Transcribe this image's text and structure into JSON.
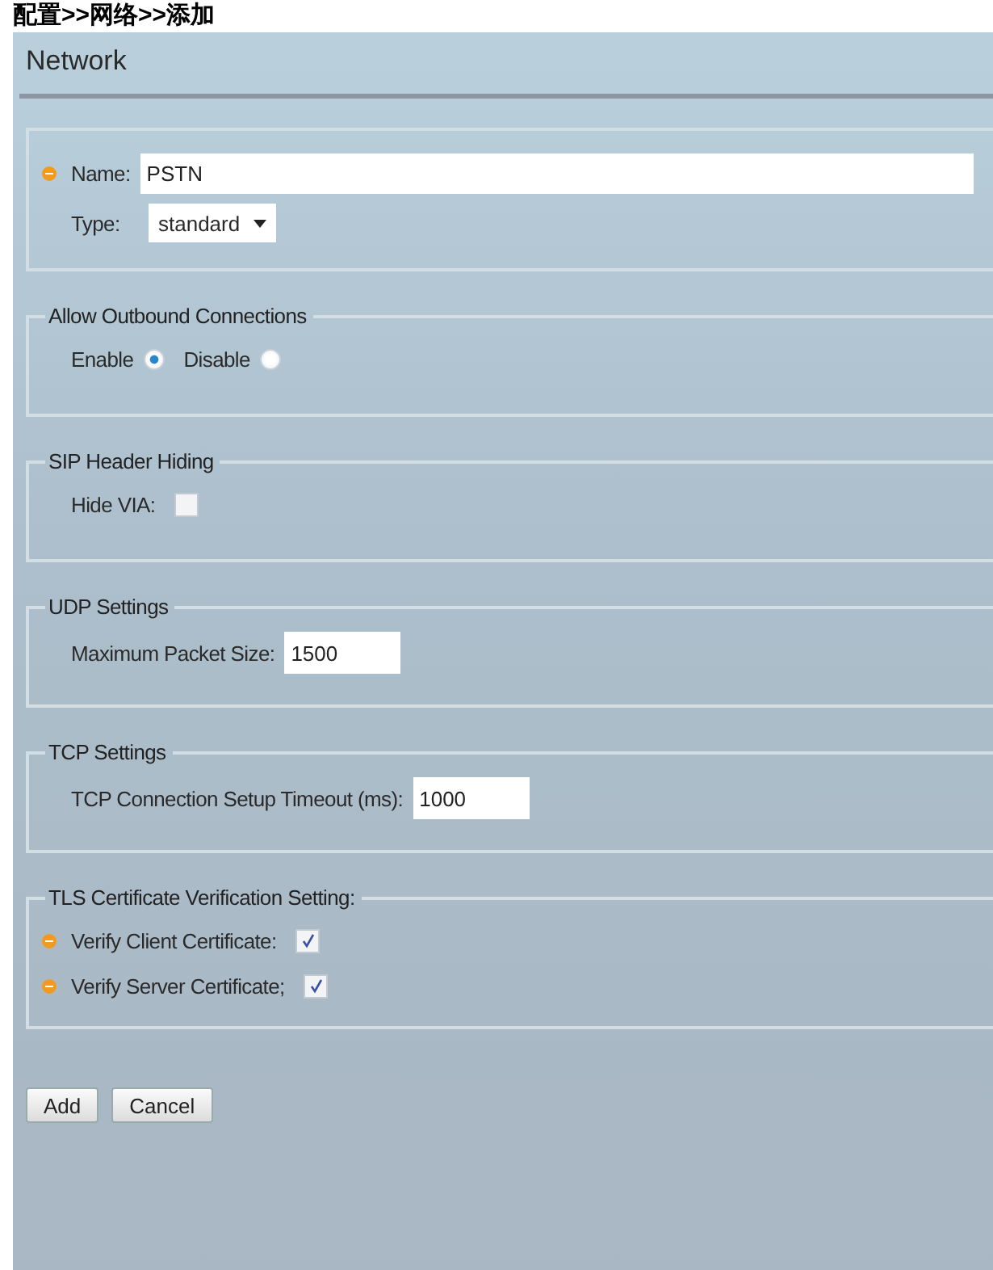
{
  "breadcrumb": "配置>>网络>>添加",
  "window": {
    "title": "Network"
  },
  "sections": [
    {
      "rows": [
        {
          "kind": "text",
          "label": "Name:",
          "required": true,
          "value": "PSTN",
          "wide": true
        },
        {
          "kind": "select",
          "label": "Type:",
          "required": false,
          "value": "standard"
        }
      ]
    },
    {
      "legend": "Allow Outbound Connections",
      "rows": [
        {
          "kind": "radio",
          "options": [
            {
              "label": "Enable",
              "selected": true
            },
            {
              "label": "Disable",
              "selected": false
            }
          ]
        }
      ]
    },
    {
      "legend": "SIP Header Hiding",
      "rows": [
        {
          "kind": "checkbox",
          "label": "Hide VIA:",
          "required": false,
          "checked": false
        }
      ]
    },
    {
      "legend": "UDP Settings",
      "rows": [
        {
          "kind": "text",
          "label": "Maximum Packet Size:",
          "required": false,
          "value": "1500",
          "wide": false
        }
      ]
    },
    {
      "legend": "TCP Settings",
      "rows": [
        {
          "kind": "text",
          "label": "TCP Connection Setup Timeout (ms):",
          "required": false,
          "value": "1000",
          "wide": false
        }
      ]
    },
    {
      "legend": "TLS Certificate Verification Setting:",
      "rows": [
        {
          "kind": "checkbox",
          "label": "Verify Client Certificate:",
          "required": true,
          "checked": true
        },
        {
          "kind": "checkbox",
          "label": "Verify Server Certificate;",
          "required": true,
          "checked": true
        }
      ]
    }
  ],
  "buttons": [
    "Add",
    "Cancel"
  ]
}
